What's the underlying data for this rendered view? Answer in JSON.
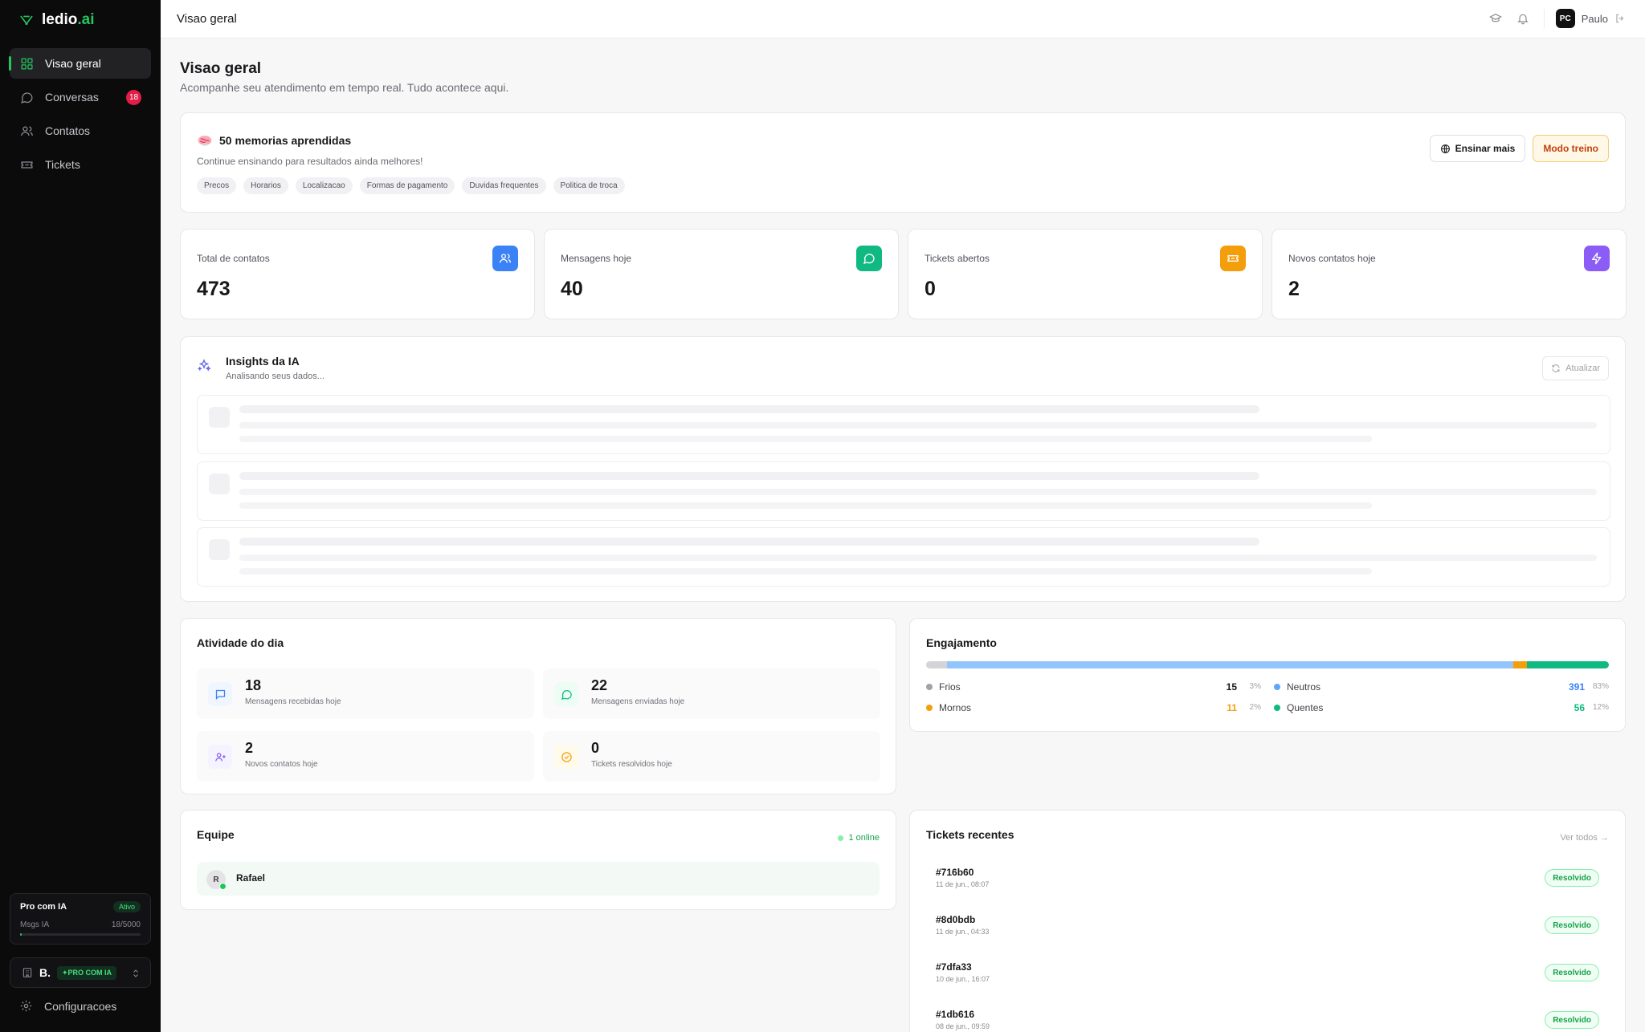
{
  "app": {
    "logo_main": "ledio",
    "logo_accent": ".ai"
  },
  "sidebar": {
    "items": [
      {
        "label": "Visao geral",
        "icon": "grid-icon",
        "active": true
      },
      {
        "label": "Conversas",
        "icon": "chat-icon",
        "badge": "18"
      },
      {
        "label": "Contatos",
        "icon": "users-icon"
      },
      {
        "label": "Tickets",
        "icon": "ticket-icon"
      }
    ],
    "plan": {
      "title": "Pro com IA",
      "status": "Ativo",
      "usage_label": "Msgs IA",
      "usage_value": "18/5000",
      "usage_fraction": 0.0036
    },
    "workspace": {
      "name": "B.",
      "tag": "PRO COM IA"
    },
    "settings_label": "Configuracoes"
  },
  "topbar": {
    "title": "Visao geral",
    "user_initials": "PC",
    "user_name": "Paulo"
  },
  "page": {
    "title": "Visao geral",
    "subtitle": "Acompanhe seu atendimento em tempo real. Tudo acontece aqui."
  },
  "memory": {
    "title": "50 memorias aprendidas",
    "subtitle": "Continue ensinando para resultados ainda melhores!",
    "chips": [
      "Precos",
      "Horarios",
      "Localizacao",
      "Formas de pagamento",
      "Duvidas frequentes",
      "Politica de troca"
    ],
    "teach_button": "Ensinar mais",
    "train_button": "Modo treino"
  },
  "stats": [
    {
      "label": "Total de contatos",
      "value": "473",
      "icon": "users-icon",
      "color": "#3b82f6"
    },
    {
      "label": "Mensagens hoje",
      "value": "40",
      "icon": "chat-icon",
      "color": "#10b981"
    },
    {
      "label": "Tickets abertos",
      "value": "0",
      "icon": "ticket-icon",
      "color": "#f59e0b"
    },
    {
      "label": "Novos contatos hoje",
      "value": "2",
      "icon": "bolt-icon",
      "color": "#8b5cf6"
    }
  ],
  "insights": {
    "title": "Insights da IA",
    "subtitle": "Analisando seus dados...",
    "refresh_label": "Atualizar"
  },
  "activity": {
    "title": "Atividade do dia",
    "tiles": [
      {
        "value": "18",
        "label": "Mensagens recebidas hoje",
        "icon": "message-square-icon"
      },
      {
        "value": "22",
        "label": "Mensagens enviadas hoje",
        "icon": "chat-icon"
      },
      {
        "value": "2",
        "label": "Novos contatos hoje",
        "icon": "user-plus-icon"
      },
      {
        "value": "0",
        "label": "Tickets resolvidos hoje",
        "icon": "check-circle-icon"
      }
    ]
  },
  "engagement": {
    "title": "Engajamento",
    "segments": [
      {
        "name": "Frios",
        "count": "15",
        "pct": "3%",
        "fraction": 0.03,
        "color": "#a1a1aa",
        "bar_color": "#d4d4d8"
      },
      {
        "name": "Neutros",
        "count": "391",
        "pct": "83%",
        "fraction": 0.83,
        "color": "#60a5fa",
        "bar_color": "#93c5fd"
      },
      {
        "name": "Mornos",
        "count": "11",
        "pct": "2%",
        "fraction": 0.02,
        "color": "#f59e0b",
        "bar_color": "#f59e0b"
      },
      {
        "name": "Quentes",
        "count": "56",
        "pct": "12%",
        "fraction": 0.12,
        "color": "#10b981",
        "bar_color": "#10b981"
      }
    ]
  },
  "team": {
    "title": "Equipe",
    "online_label": "1 online",
    "members": [
      {
        "initial": "R",
        "name": "Rafael"
      }
    ]
  },
  "tickets": {
    "title": "Tickets recentes",
    "see_all": "Ver todos",
    "rows": [
      {
        "id": "#716b60",
        "date": "11 de jun., 08:07",
        "status": "Resolvido"
      },
      {
        "id": "#8d0bdb",
        "date": "11 de jun., 04:33",
        "status": "Resolvido"
      },
      {
        "id": "#7dfa33",
        "date": "10 de jun., 16:07",
        "status": "Resolvido"
      },
      {
        "id": "#1db616",
        "date": "08 de jun., 09:59",
        "status": "Resolvido"
      }
    ]
  }
}
